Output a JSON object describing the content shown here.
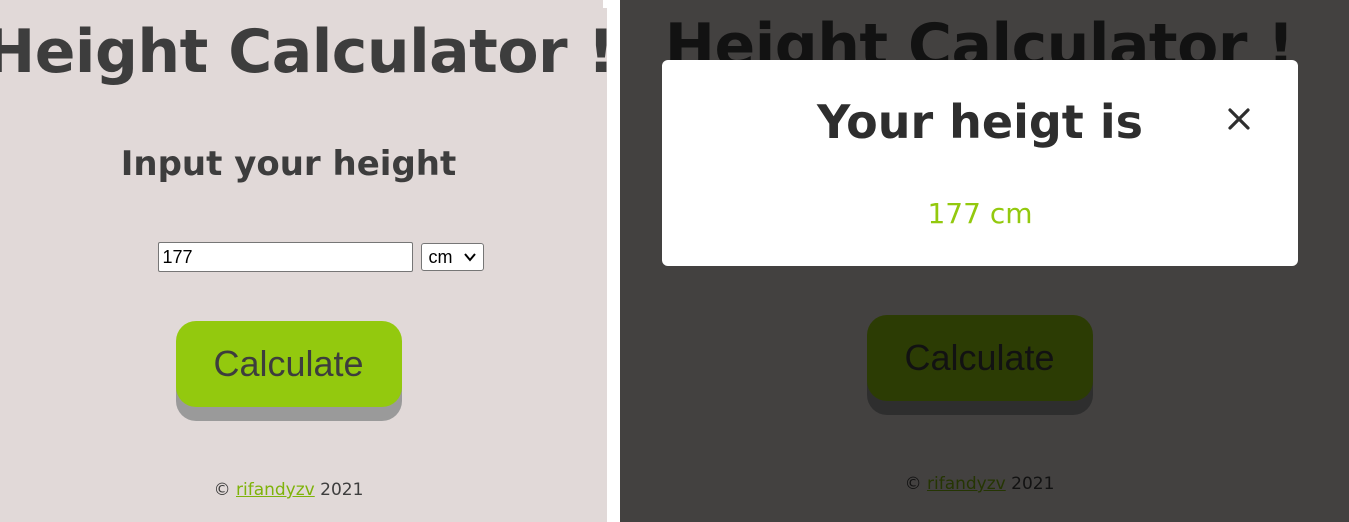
{
  "app": {
    "title": "Height Calculator !",
    "subtitle": "Input your height"
  },
  "form": {
    "height_value": "177",
    "unit_selected": "cm",
    "calculate_label": "Calculate"
  },
  "footer": {
    "copyright_symbol": "©",
    "author_link": "rifandyzv",
    "year": "2021"
  },
  "modal": {
    "title": "Your heigt is",
    "result": "177 cm",
    "close_label": "×"
  },
  "colors": {
    "background": "#e1d9d8",
    "accent": "#93c90e",
    "text": "#3d3d3d",
    "link": "#7eb30a",
    "overlay": "rgba(0,0,0,0.7)"
  },
  "icons": {
    "unit_dropdown": "chevron-down-icon",
    "modal_close": "close-icon"
  }
}
